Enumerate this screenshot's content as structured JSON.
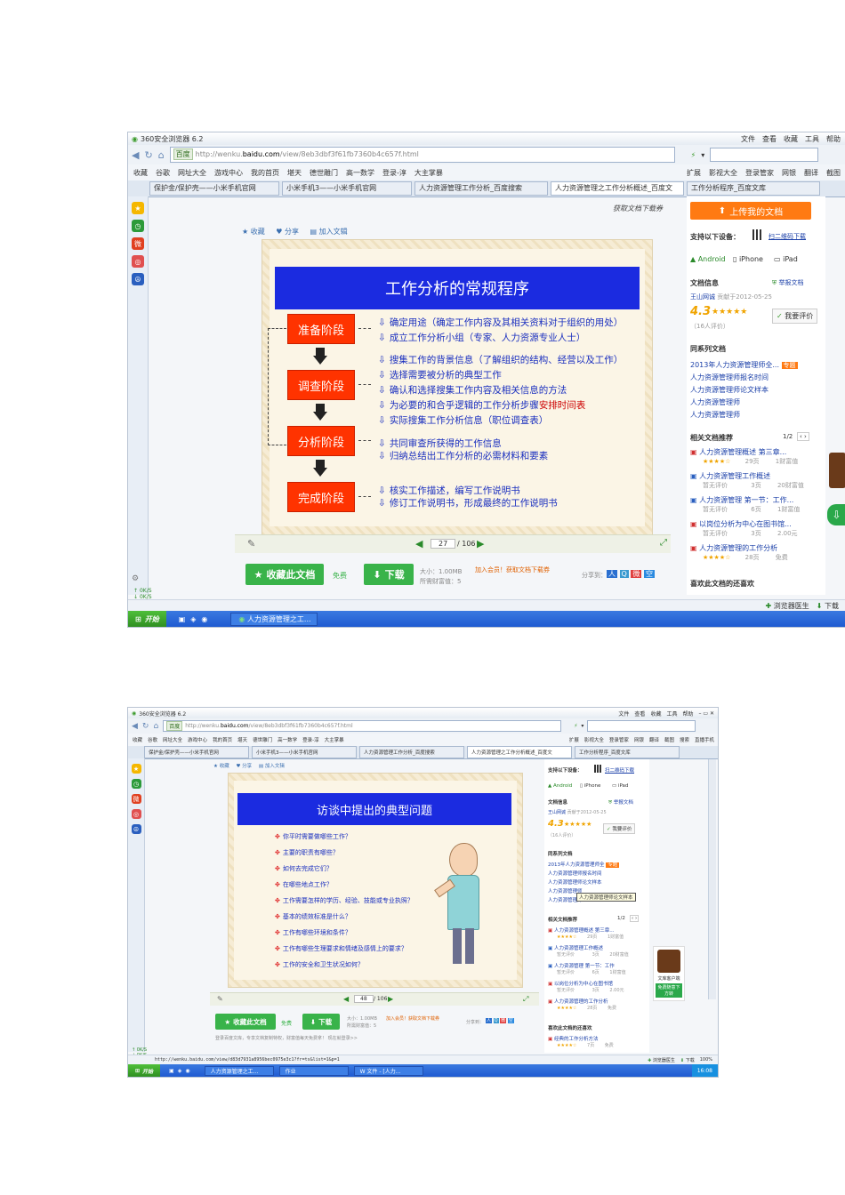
{
  "shot1": {
    "browser": {
      "title": "360安全浏览器 6.2",
      "menu": [
        "文件",
        "查看",
        "收藏",
        "工具",
        "帮助"
      ]
    },
    "address": {
      "search_engine": "百度",
      "url_prefix": "http://wenku.",
      "url_domain": "baidu.com",
      "url_path": "/view/8eb3dbf3f61fb7360b4c657f.html"
    },
    "favorites": [
      "收藏",
      "谷歌",
      "网址大全",
      "游戏中心",
      "我的首页",
      "堪天",
      "德世雕门",
      "高一数学",
      "登录-淳",
      "大主掌暴"
    ],
    "favorites_right": [
      "扩展",
      "影视大全",
      "登录管家",
      "网银",
      "翻译",
      "截图"
    ],
    "tabs": [
      "保护金/保护壳——小米手机官网",
      "小米手机3——小米手机官网",
      "人力资源管理工作分析_百度搜索",
      "人力资源管理之工作分析概述_百度文",
      "工作分析程序_百度文库"
    ],
    "doc_toolbar": [
      "收藏",
      "分享",
      "加入文辑"
    ],
    "get_doc": "获取文档下载券",
    "slide": {
      "title": "工作分析的常规程序",
      "stages": [
        "准备阶段",
        "调查阶段",
        "分析阶段",
        "完成阶段"
      ],
      "items": [
        "确定用途（确定工作内容及其相关资料对于组织的用处）",
        "成立工作分析小组（专家、人力资源专业人士）",
        "搜集工作的背景信息（了解组织的结构、经营以及工作）",
        "选择需要被分析的典型工作",
        "确认和选择搜集工作内容及相关信息的方法",
        "为必要的和合乎逻辑的工作分析步骤",
        "实际搜集工作分析信息（职位调查表）",
        "共同审查所获得的工作信息",
        "归纳总结出工作分析的必需材料和要素",
        "核实工作描述，编写工作说明书",
        "修订工作说明书，形成最终的工作说明书"
      ],
      "item_highlight": "安排时间表"
    },
    "pager": {
      "current": "27",
      "total": "/ 106"
    },
    "actions": {
      "collect": "收藏此文档",
      "free": "免费",
      "download": "下载",
      "size": "大小：1.00MB",
      "cost": "所需财富值：5",
      "vip": "加入会员！获取文档下载券",
      "share": "分享到："
    },
    "side": {
      "upload": "上传我的文档",
      "devices_label": "支持以下设备：",
      "qr": "扫二维码下载",
      "devices": [
        "Android",
        "iPhone",
        "iPad"
      ],
      "info_label": "文档信息",
      "report": "举报文档",
      "author": "王山网诚",
      "contrib": "贡献于2012-05-25",
      "rating": "4.3",
      "rating_count": "（16人评价）",
      "rate_btn": "我要评价",
      "series_label": "同系列文档",
      "series": [
        "2013年人力资源管理师全...",
        "人力资源管理师报名时间",
        "人力资源管理师论文样本",
        "人力资源管理师",
        "人力资源管理师"
      ],
      "series_badge": "专题",
      "related_label": "相关文档推荐",
      "related_page": "1/2",
      "related": [
        {
          "title": "人力资源管理概述 第三章...",
          "a": "29页",
          "b": "1财富值"
        },
        {
          "title": "人力资源管理工作概述",
          "a": "3页",
          "b": "20财富值"
        },
        {
          "title": "人力资源管理 第一节：工作...",
          "a": "6页",
          "b": "1财富值"
        },
        {
          "title": "以岗位分析为中心在图书馆...",
          "a": "3页",
          "b": "2.00元"
        },
        {
          "title": "人力资源管理的工作分析",
          "a": "28页",
          "b": "免费"
        }
      ],
      "no_rating": "暂无评价",
      "also_like": "喜欢此文档的还喜欢"
    },
    "net": [
      "0K/S",
      "0K/S"
    ],
    "status": [
      "浏览器医生",
      "下载"
    ],
    "taskbar": {
      "start": "开始",
      "task": "人力资源管理之工..."
    }
  },
  "shot2": {
    "browser": {
      "title": "360安全浏览器 6.2",
      "menu": [
        "文件",
        "查看",
        "收藏",
        "工具",
        "帮助"
      ]
    },
    "address": {
      "search_engine": "百度",
      "url_prefix": "http://wenku.",
      "url_domain": "baidu.com",
      "url_path": "/view/8eb3dbf3f61fb7360b4c657f.html"
    },
    "favorites": [
      "收藏",
      "谷歌",
      "网址大全",
      "游戏中心",
      "我的首页",
      "堪天",
      "德世雕门",
      "高一数学",
      "登录-淳",
      "大主掌暴"
    ],
    "favorites_right": [
      "扩展",
      "影视大全",
      "登录管家",
      "网银",
      "翻译",
      "截图",
      "搜索",
      "直播手机"
    ],
    "tabs": [
      "保护金/保护壳——小米手机官网",
      "小米手机3——小米手机官网",
      "人力资源管理工作分析_百度搜索",
      "人力资源管理之工作分析概述_百度文",
      "工作分析程序_百度文库"
    ],
    "doc_toolbar": [
      "收藏",
      "分享",
      "加入文辑"
    ],
    "slide": {
      "title": "访谈中提出的典型问题",
      "questions": [
        "你平时需要做哪些工作？",
        "主要的职责有哪些？",
        "如何去完成它们？",
        "在哪些地点工作？",
        "工作需要怎样的学历、经验、技能或专业执照？",
        "基本的绩效标准是什么？",
        "工作有哪些环境和条件？",
        "工作有哪些生理要求和情绪及感情上的要求？",
        "工作的安全和卫生状况如何？"
      ]
    },
    "pager": {
      "current": "48",
      "total": "/ 106"
    },
    "actions": {
      "collect": "收藏此文档",
      "free": "免费",
      "download": "下载",
      "size": "大小：1.00MB",
      "cost": "所需财富值：5",
      "vip": "加入会员！获取文档下载券",
      "share": "分享到：",
      "note": "登录百度文库，专享文档复制特权，财富值每天免费拿！ 现在就登录>>"
    },
    "side": {
      "devices_label": "支持以下设备：",
      "qr": "扫二维码下载",
      "devices": [
        "Android",
        "iPhone",
        "iPad"
      ],
      "info_label": "文档信息",
      "report": "举报文档",
      "author": "王山网诚",
      "contrib": "贡献于2012-05-25",
      "rating": "4.3",
      "rating_count": "（16人评价）",
      "rate_btn": "我要评价",
      "series_label": "同系列文档",
      "series": [
        "2013年人力资源管理师全",
        "人力资源管理师报名时间",
        "人力资源管理师论文样本",
        "人力资源管理师",
        "人力资源管理师"
      ],
      "series_badge": "专题",
      "tooltip": "人力资源管理师论文样本",
      "related_label": "相关文档推荐",
      "related_page": "1/2",
      "related": [
        {
          "title": "人力资源管理概述 第三章...",
          "a": "29页",
          "b": "1财富值"
        },
        {
          "title": "人力资源管理工作概述",
          "a": "3页",
          "b": "20财富值"
        },
        {
          "title": "人力资源管理 第一节：工作",
          "a": "6页",
          "b": "1财富值"
        },
        {
          "title": "以岗位分析为中心在图书馆",
          "a": "3页",
          "b": "2.00元"
        },
        {
          "title": "人力资源管理的工作分析",
          "a": "28页",
          "b": "免费"
        }
      ],
      "no_rating": "暂无评价",
      "also_like": "喜欢此文档的还喜欢",
      "also_like_item": {
        "title": "经典的工作分析方法",
        "a": "7页",
        "b": "免费"
      },
      "ad": "文库客户端",
      "ad_btn": "免费随意下方转"
    },
    "net": [
      "0K/S",
      "0K/S"
    ],
    "status_url": "http://wenku.baidu.com/view/d83d7931a8956bec0975e3c1?fr=ts&list=1&p=1",
    "status": [
      "浏览器医生",
      "下载",
      "100%"
    ],
    "taskbar": {
      "start": "开始",
      "tasks": [
        "人力资源管理之工...",
        "作业",
        "W 文件 - [人力..."
      ],
      "time": "16:08"
    }
  }
}
